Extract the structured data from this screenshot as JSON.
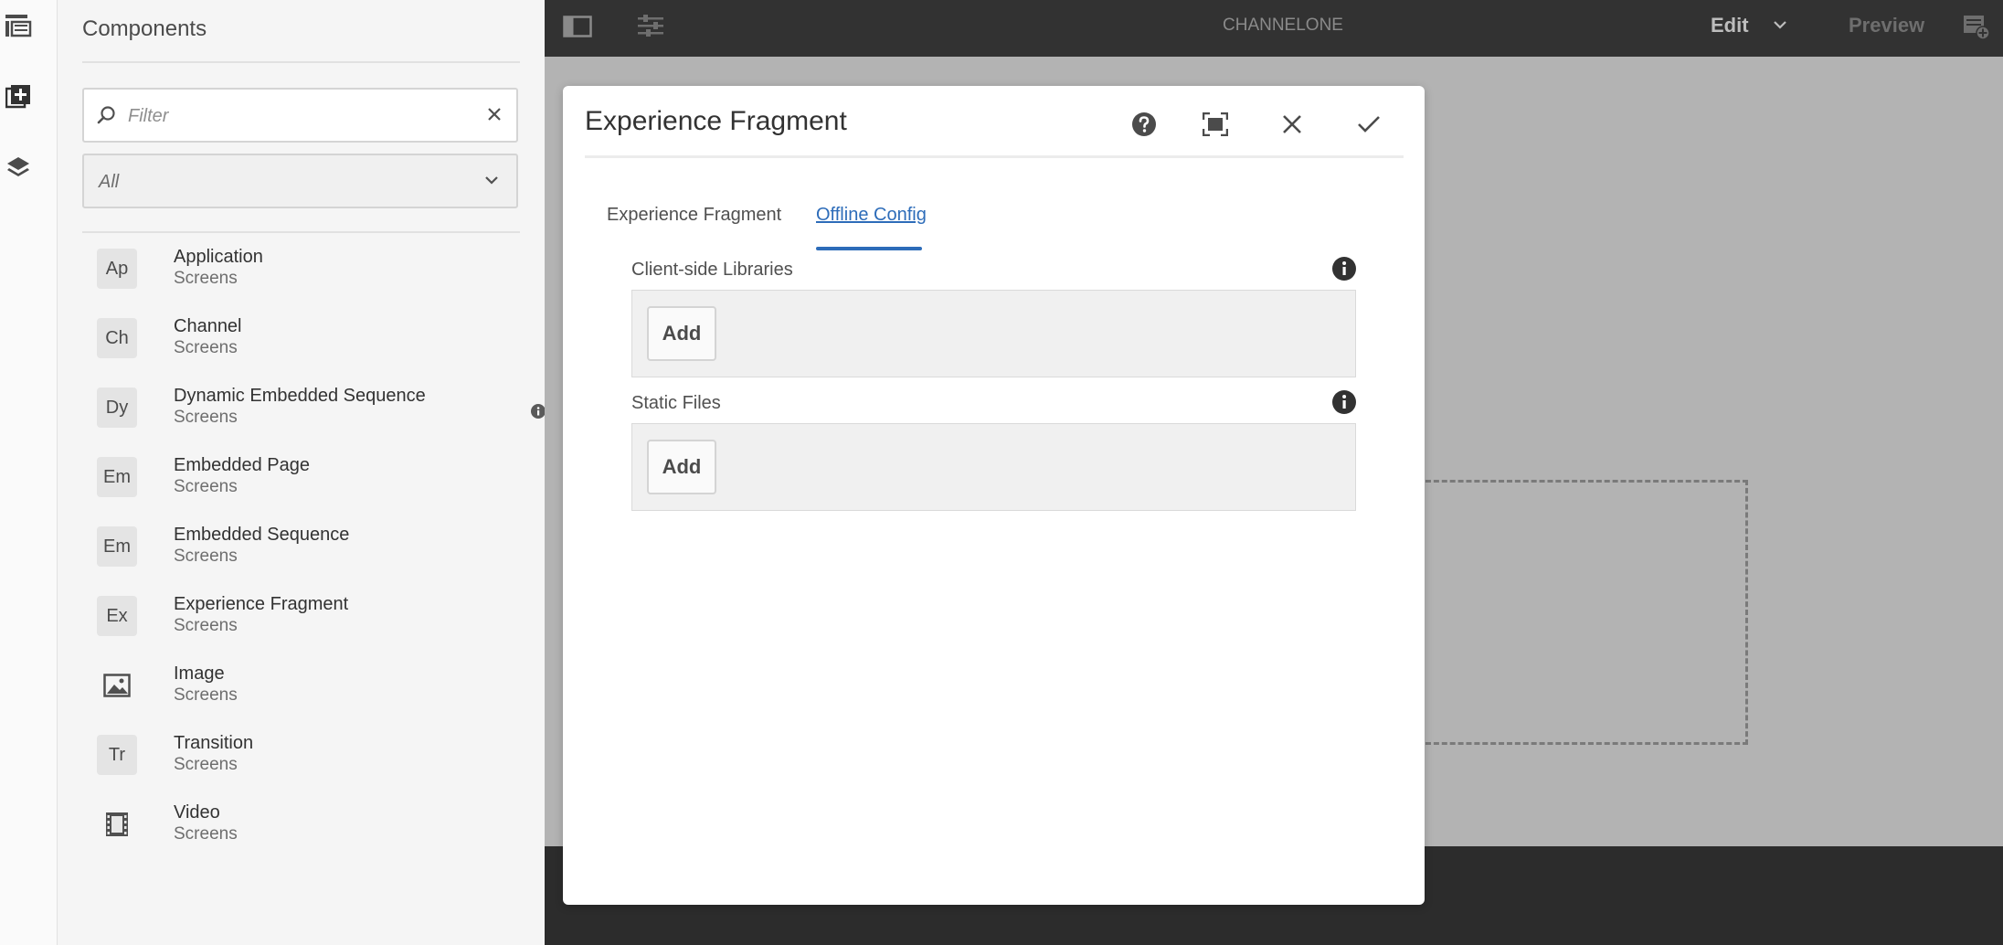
{
  "rail": {
    "icons": [
      "site-structure-icon",
      "add-component-icon",
      "layers-icon"
    ]
  },
  "panel": {
    "title": "Components",
    "filter": {
      "placeholder": "Filter",
      "value": ""
    },
    "group_select": {
      "value": "All"
    },
    "items": [
      {
        "badge": "Ap",
        "name": "Application",
        "group": "Screens"
      },
      {
        "badge": "Ch",
        "name": "Channel",
        "group": "Screens"
      },
      {
        "badge": "Dy",
        "name": "Dynamic Embedded Sequence",
        "group": "Screens",
        "has_info": true
      },
      {
        "badge": "Em",
        "name": "Embedded Page",
        "group": "Screens"
      },
      {
        "badge": "Em",
        "name": "Embedded Sequence",
        "group": "Screens"
      },
      {
        "badge": "Ex",
        "name": "Experience Fragment",
        "group": "Screens"
      },
      {
        "badge": "",
        "icon": "image-icon",
        "name": "Image",
        "group": "Screens"
      },
      {
        "badge": "Tr",
        "name": "Transition",
        "group": "Screens"
      },
      {
        "badge": "",
        "icon": "video-icon",
        "name": "Video",
        "group": "Screens"
      }
    ]
  },
  "topbar": {
    "channel_name": "CHANNELONE",
    "edit_label": "Edit",
    "preview_label": "Preview"
  },
  "dialog": {
    "title": "Experience Fragment",
    "tabs": [
      {
        "label": "Experience Fragment",
        "active": false
      },
      {
        "label": "Offline Config",
        "active": true
      }
    ],
    "fields": [
      {
        "label": "Client-side Libraries",
        "add_label": "Add"
      },
      {
        "label": "Static Files",
        "add_label": "Add"
      }
    ]
  },
  "colors": {
    "topbar_bg": "#323232",
    "canvas_bg": "#b3b3b3",
    "accent": "#2d6cb9",
    "panel_bg": "#f5f5f5"
  }
}
